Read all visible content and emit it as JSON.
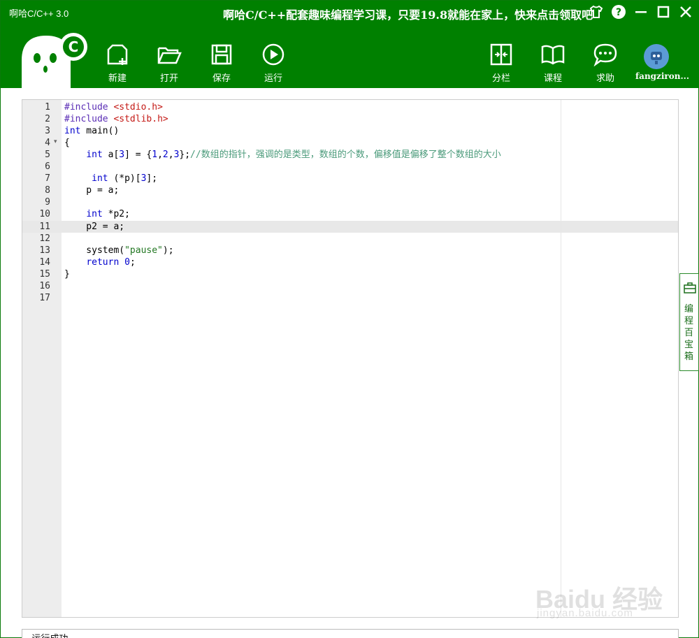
{
  "window": {
    "title": "啊哈C/C++ 3.0",
    "promo": "啊哈C/C++配套趣味编程学习课，只要19.8就能在家上，快来点击领取吧"
  },
  "toolbar": {
    "new_label": "新建",
    "open_label": "打开",
    "save_label": "保存",
    "run_label": "运行",
    "split_label": "分栏",
    "course_label": "课程",
    "help_label": "求助",
    "username": "fangziron..."
  },
  "editor": {
    "line_numbers": [
      "1",
      "2",
      "3",
      "4",
      "5",
      "6",
      "7",
      "8",
      "9",
      "10",
      "11",
      "12",
      "13",
      "14",
      "15",
      "16",
      "17"
    ],
    "active_line": 11,
    "code": {
      "l1_directive": "#include",
      "l1_header": "<stdio.h>",
      "l2_directive": "#include",
      "l2_header": "<stdlib.h>",
      "l3_type": "int",
      "l3_rest": " main()",
      "l4": "{",
      "l5_indent": "    ",
      "l5_type": "int",
      "l5_a": " a[",
      "l5_n3": "3",
      "l5_b": "] = {",
      "l5_n1": "1",
      "l5_c1": ",",
      "l5_n2": "2",
      "l5_c2": ",",
      "l5_n3b": "3",
      "l5_end": "};",
      "l5_comment": "//数组的指针，强调的是类型，数组的个数，偏移值是偏移了整个数组的大小",
      "l7_indent": "     ",
      "l7_type": "int",
      "l7_a": " (*p)[",
      "l7_n": "3",
      "l7_b": "];",
      "l8": "    p = a;",
      "l10_indent": "    ",
      "l10_type": "int",
      "l10_rest": " *p2;",
      "l11": "    p2 = a;",
      "l13_a": "    system(",
      "l13_str": "\"pause\"",
      "l13_b": ");",
      "l14_indent": "    ",
      "l14_kw": "return",
      "l14_sp": " ",
      "l14_n": "0",
      "l14_end": ";",
      "l15": "}"
    }
  },
  "side_panel": {
    "label": "编程百宝箱"
  },
  "output": {
    "text": "--运行成功--"
  },
  "watermark": {
    "line1": "Baidu 经验",
    "line2": "jingyan.baidu.com"
  },
  "colors": {
    "brand_green": "#008000",
    "keyword": "#0000cd",
    "comment": "#4a9a7a",
    "header": "#c41a16"
  }
}
